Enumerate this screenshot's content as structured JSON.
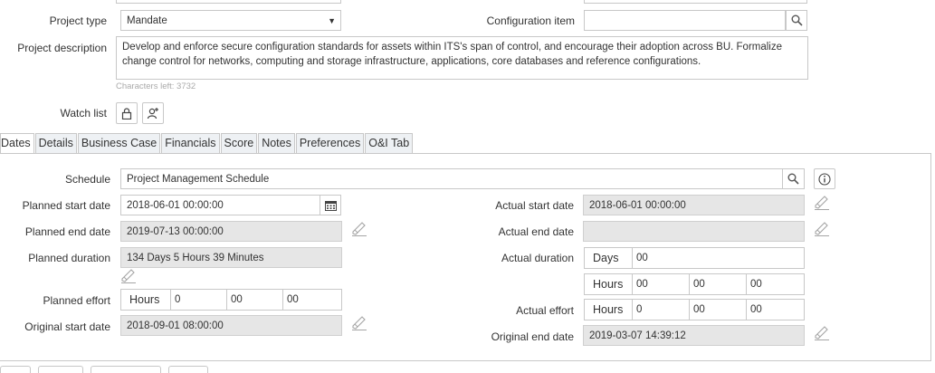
{
  "header": {
    "project_type_label": "Project type",
    "project_type_value": "Mandate",
    "configuration_item_label": "Configuration item",
    "configuration_item_value": "",
    "description_label": "Project description",
    "description_value": "Develop and enforce secure configuration standards for assets within ITS's span of control, and encourage their adoption across BU.  Formalize change control for networks, computing and storage infrastructure, applications, core databases and reference configurations.",
    "characters_left": "Characters left: 3732",
    "watch_list_label": "Watch list"
  },
  "tabs": [
    {
      "label": "Dates",
      "active": true
    },
    {
      "label": "Details",
      "active": false
    },
    {
      "label": "Business Case",
      "active": false
    },
    {
      "label": "Financials",
      "active": false
    },
    {
      "label": "Score",
      "active": false
    },
    {
      "label": "Notes",
      "active": false
    },
    {
      "label": "Preferences",
      "active": false
    },
    {
      "label": "O&I Tab",
      "active": false
    }
  ],
  "dates": {
    "schedule_label": "Schedule",
    "schedule_value": "Project Management Schedule",
    "planned_start_label": "Planned start date",
    "planned_start_value": "2018-06-01 00:00:00",
    "planned_end_label": "Planned end date",
    "planned_end_value": "2019-07-13 00:00:00",
    "planned_duration_label": "Planned duration",
    "planned_duration_value": "134 Days 5 Hours 39 Minutes",
    "planned_effort_label": "Planned effort",
    "planned_effort_unit": "Hours",
    "planned_effort_values": [
      "0",
      "00",
      "00"
    ],
    "original_start_label": "Original start date",
    "original_start_value": "2018-09-01 08:00:00",
    "actual_start_label": "Actual start date",
    "actual_start_value": "2018-06-01 00:00:00",
    "actual_end_label": "Actual end date",
    "actual_end_value": "",
    "actual_duration_label": "Actual duration",
    "actual_duration_days_unit": "Days",
    "actual_duration_days_value": "00",
    "actual_duration_hours_unit": "Hours",
    "actual_duration_hours_values": [
      "00",
      "00",
      "00"
    ],
    "actual_effort_label": "Actual effort",
    "actual_effort_unit": "Hours",
    "actual_effort_values": [
      "0",
      "00",
      "00"
    ],
    "original_end_label": "Original end date",
    "original_end_value": "2019-03-07 14:39:12"
  },
  "icons": {
    "search": "search-icon",
    "info": "info-icon",
    "calendar": "calendar-icon",
    "edit": "edit-icon",
    "lock": "lock-icon",
    "add_user": "add-user-icon",
    "dropdown": "chevron-down-icon"
  }
}
